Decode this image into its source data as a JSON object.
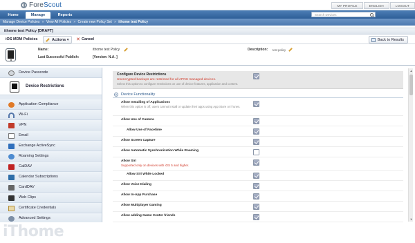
{
  "app": {
    "logo_text_gray": "Fore",
    "logo_text_blue": "Scout"
  },
  "top_links": [
    "MY PROFILE",
    "ENGLISH",
    "LOGOUT"
  ],
  "nav": {
    "tabs": [
      "Home",
      "Manage",
      "Reports"
    ],
    "active_tab": "Manage",
    "search_placeholder": "Search Devices"
  },
  "breadcrumb": [
    "Manage Device Policies",
    "»",
    "View All Policies",
    "»",
    "Create new Policy Set",
    "»",
    "ithome test Policy"
  ],
  "page_title": "ithome test Policy [DRAFT]",
  "toolbar": {
    "policy_type": "iOS MDM Policies",
    "actions_label": "Actions",
    "cancel_label": "Cancel",
    "back_label": "Back to Results"
  },
  "meta": {
    "name_label": "Name:",
    "name_value": "ithome test Policy",
    "publish_label": "Last Successful Publish:",
    "publish_value": "[Version: N.A. ]",
    "description_label": "Description:",
    "description_value": "test policy"
  },
  "sidebar": {
    "items": [
      {
        "label": "Device Passcode",
        "icon": "passcode-icon",
        "active": false
      },
      {
        "label": "Device Restrictions",
        "icon": "device-icon",
        "active": true
      },
      {
        "label": "Application Compliance",
        "icon": "app-compliance-icon",
        "active": false
      },
      {
        "label": "Wi-Fi",
        "icon": "wifi-icon",
        "active": false
      },
      {
        "label": "VPN",
        "icon": "vpn-icon",
        "active": false
      },
      {
        "label": "Email",
        "icon": "email-icon",
        "active": false
      },
      {
        "label": "Exchange ActiveSync",
        "icon": "exchange-icon",
        "active": false
      },
      {
        "label": "Roaming Settings",
        "icon": "roaming-icon",
        "active": false
      },
      {
        "label": "CalDAV",
        "icon": "caldav-icon",
        "active": false
      },
      {
        "label": "Calendar Subscriptions",
        "icon": "calendar-sub-icon",
        "active": false
      },
      {
        "label": "CardDAV",
        "icon": "carddav-icon",
        "active": false
      },
      {
        "label": "Web Clips",
        "icon": "webclips-icon",
        "active": false
      },
      {
        "label": "Certificate Credentials",
        "icon": "certificate-icon",
        "active": false
      },
      {
        "label": "Advanced Settings",
        "icon": "advanced-icon",
        "active": false
      }
    ]
  },
  "configure": {
    "title": "Configure Device Restrictions",
    "warning": "Unencrypted backups are restricted for all APNS managed devices.",
    "description": "Select this option to configure restrictions on use of device features, application and content.",
    "checked": true
  },
  "section": {
    "title": "Device Functionality"
  },
  "rows": [
    {
      "label": "Allow Installing of Applications",
      "sub": "When this option is off, users cannot install or update their apps using App Store or iTunes.",
      "warn": "",
      "indent": false,
      "checked": true
    },
    {
      "label": "Allow Use of Camera",
      "sub": "",
      "warn": "",
      "indent": false,
      "checked": true
    },
    {
      "label": "Allow Use of Facetime",
      "sub": "",
      "warn": "",
      "indent": true,
      "checked": true
    },
    {
      "label": "Allow Screen Capture",
      "sub": "",
      "warn": "",
      "indent": false,
      "checked": true
    },
    {
      "label": "Allow Automatic Synchronization While Roaming",
      "sub": "",
      "warn": "",
      "indent": false,
      "checked": false
    },
    {
      "label": "Allow Siri",
      "sub": "",
      "warn": "Supported only on devices with iOS 5 and higher.",
      "indent": false,
      "checked": true
    },
    {
      "label": "Allow Siri While Locked",
      "sub": "",
      "warn": "",
      "indent": true,
      "checked": true
    },
    {
      "label": "Allow Voice Dialing",
      "sub": "",
      "warn": "",
      "indent": false,
      "checked": true
    },
    {
      "label": "Allow In-App Purchase",
      "sub": "",
      "warn": "",
      "indent": false,
      "checked": true
    },
    {
      "label": "Allow Multiplayer Gaming",
      "sub": "",
      "warn": "",
      "indent": false,
      "checked": true
    },
    {
      "label": "Allow adding Game Center friends",
      "sub": "",
      "warn": "",
      "indent": false,
      "checked": true
    }
  ],
  "watermark": "iThome"
}
